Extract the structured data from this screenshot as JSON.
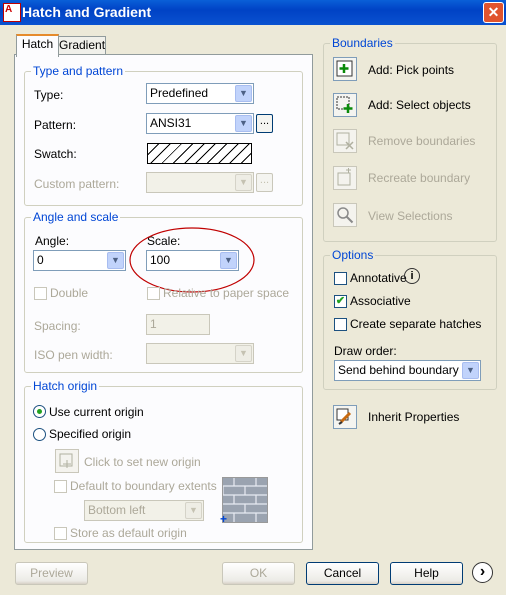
{
  "window": {
    "title": "Hatch and Gradient",
    "close": "✕",
    "app_icon_text": "A"
  },
  "tabs": [
    {
      "label": "Hatch"
    },
    {
      "label": "Gradient"
    }
  ],
  "type_and_pattern": {
    "legend": "Type and pattern",
    "type_label": "Type:",
    "type_value": "Predefined",
    "pattern_label": "Pattern:",
    "pattern_value": "ANSI31",
    "ellipsis": "...",
    "swatch_label": "Swatch:",
    "custom_pattern_label": "Custom pattern:"
  },
  "angle_and_scale": {
    "legend": "Angle and scale",
    "angle_label": "Angle:",
    "angle_value": "0",
    "scale_label": "Scale:",
    "scale_value": "100",
    "double_label": "Double",
    "relative_label": "Relative to paper space",
    "spacing_label": "Spacing:",
    "spacing_value": "1",
    "iso_label": "ISO pen width:"
  },
  "hatch_origin": {
    "legend": "Hatch origin",
    "use_current": "Use current origin",
    "specified": "Specified origin",
    "click_to_set": "Click to set new origin",
    "default_boundary": "Default to boundary extents",
    "position_value": "Bottom left",
    "store_default": "Store as default origin"
  },
  "boundaries": {
    "legend": "Boundaries",
    "add_pick": "Add: Pick points",
    "add_select": "Add: Select objects",
    "remove": "Remove boundaries",
    "recreate": "Recreate boundary",
    "view": "View Selections"
  },
  "options": {
    "legend": "Options",
    "annotative": "Annotative",
    "associative": "Associative",
    "separate": "Create separate hatches",
    "draw_order_label": "Draw order:",
    "draw_order_value": "Send behind boundary",
    "info_icon": "i"
  },
  "inherit": "Inherit Properties",
  "buttons": {
    "preview": "Preview",
    "ok": "OK",
    "cancel": "Cancel",
    "help": "Help",
    "more": "›"
  },
  "annotation": {
    "highlight_color": "#c00000"
  },
  "checked": {
    "associative": "✔"
  }
}
